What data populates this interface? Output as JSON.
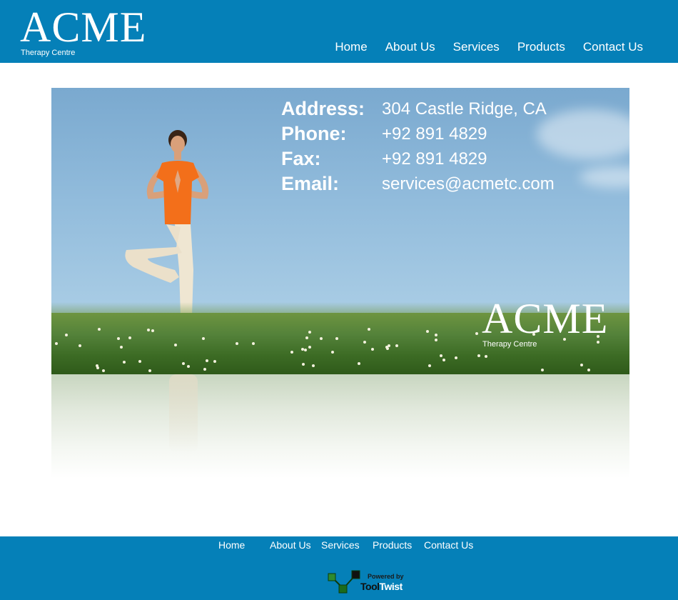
{
  "header": {
    "logo_word": "ACME",
    "logo_sub": "Therapy Centre",
    "nav": [
      "Home",
      "About Us",
      "Services",
      "Products",
      "Contact Us"
    ]
  },
  "hero": {
    "contact": [
      {
        "label": "Address:",
        "value": "304 Castle Ridge, CA"
      },
      {
        "label": "Phone:",
        "value": "+92 891 4829"
      },
      {
        "label": "Fax:",
        "value": "+92 891 4829"
      },
      {
        "label": "Email:",
        "value": "services@acmetc.com"
      }
    ],
    "logo_word": "ACME",
    "logo_sub": "Therapy Centre"
  },
  "footer": {
    "nav": [
      "Home",
      "About Us",
      "Services",
      "Products",
      "Contact Us"
    ],
    "powered_by": "Powered by",
    "brand_a": "Tool",
    "brand_b": "Twist"
  },
  "colors": {
    "brand_blue": "#0580b8",
    "shirt_orange": "#f36f1a"
  }
}
